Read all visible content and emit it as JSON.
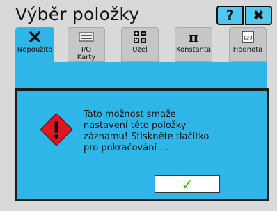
{
  "window": {
    "title": "Výběr položky"
  },
  "top_buttons": {
    "help": "?",
    "close": "✖"
  },
  "tabs": [
    {
      "label": "Nepoužito",
      "icon": "x-icon",
      "active": true
    },
    {
      "label": "I/O\nKarty",
      "icon": "io-card-icon",
      "active": false
    },
    {
      "label": "Uzel",
      "icon": "calculator-icon",
      "active": false
    },
    {
      "label": "Konstanta",
      "icon": "pi-icon",
      "active": false
    },
    {
      "label": "Hodnota",
      "icon": "value-123-icon",
      "active": false
    }
  ],
  "dialog": {
    "message": "Tato možnost smaže nastavení této položky záznamu! Stiskněte tlačítko pro pokračování ...",
    "ok_glyph": "✓"
  },
  "colors": {
    "accent": "#2eb6e8",
    "button": "#4ec8ef",
    "warning": "#e0161e",
    "ok": "#32b000"
  }
}
